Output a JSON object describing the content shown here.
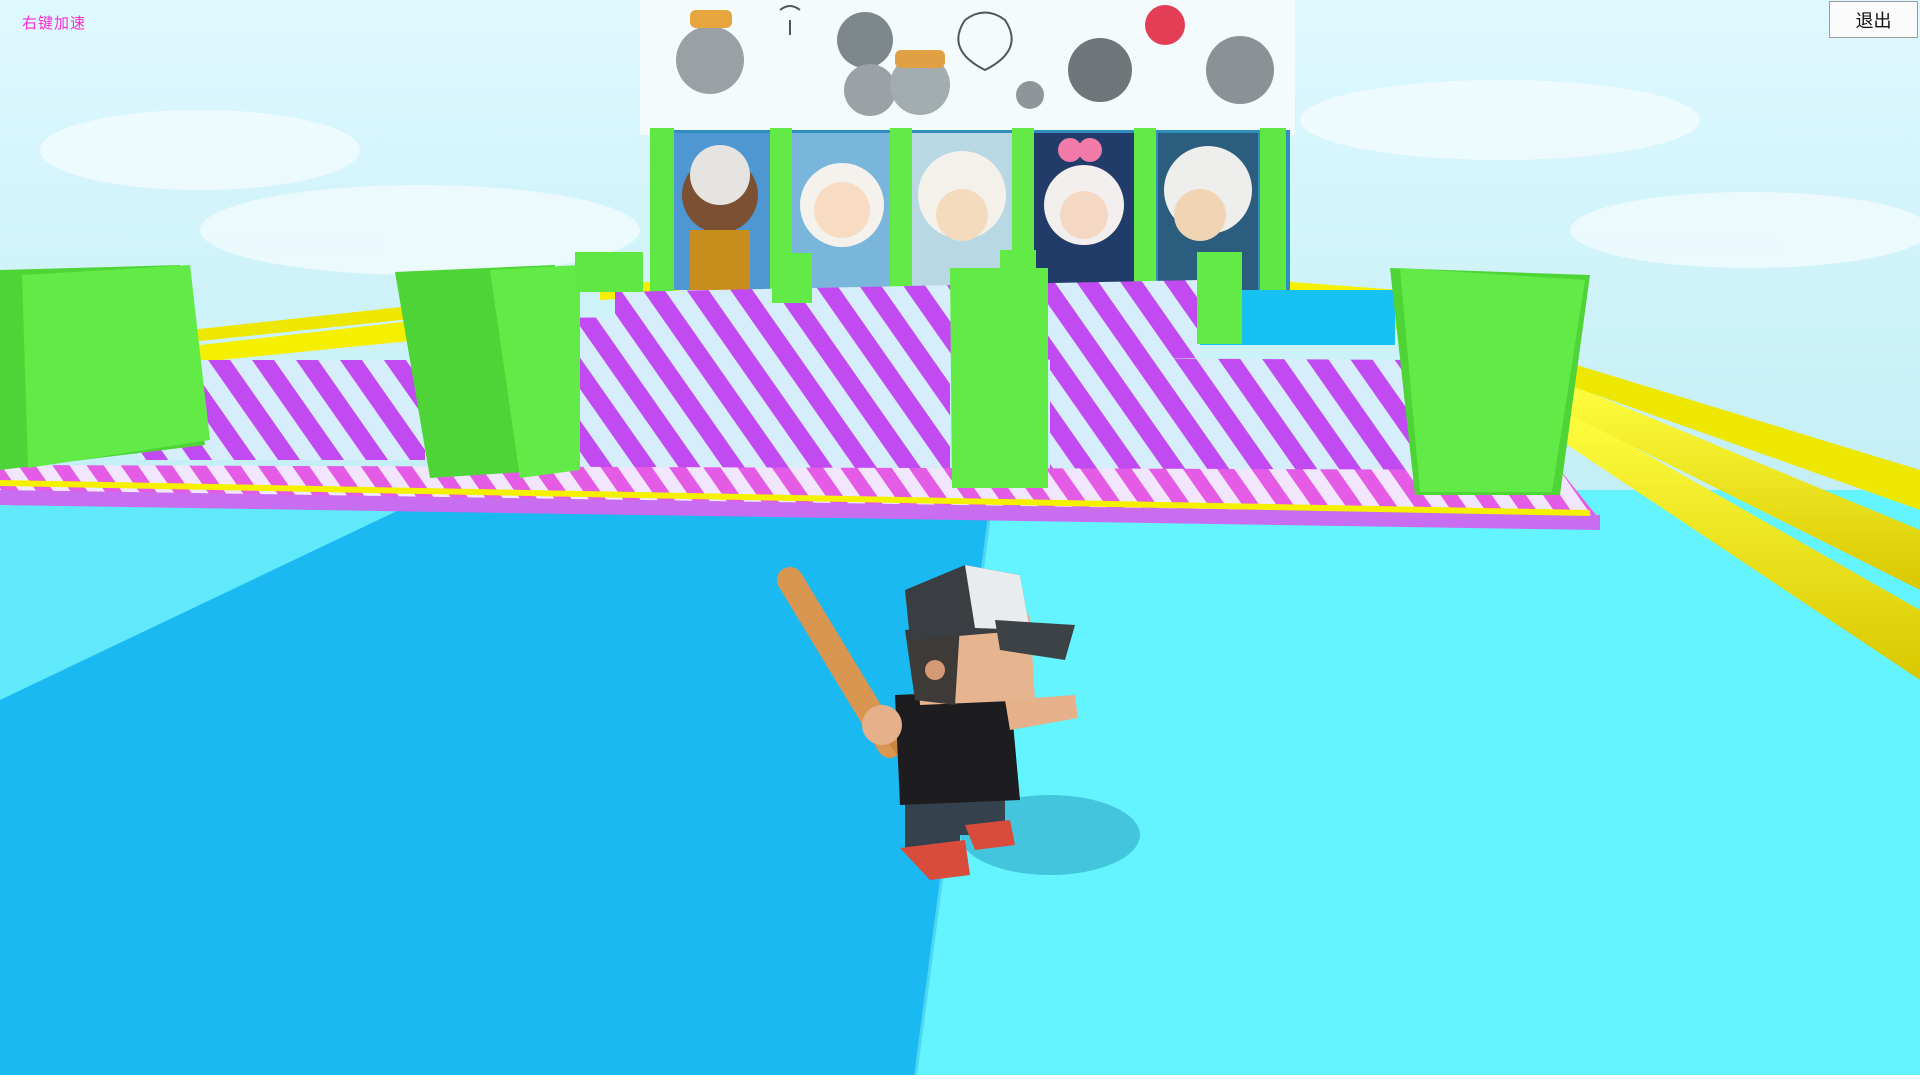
{
  "hud": {
    "hint_text": "右键加速",
    "exit_label": "退出"
  },
  "scene": {
    "billboard_posters": [
      "bearded-goat-poster",
      "white-goat-poster",
      "lazy-goat-poster",
      "pink-bow-goat-poster",
      "old-goat-poster"
    ],
    "billboard_top_image": "wolves-and-goats-doodle",
    "player_character": "baseball-kid-with-bat",
    "colors": {
      "sky_top": "#dff8ff",
      "sky_bottom": "#bdeef5",
      "floor_light": "#63f4ff",
      "floor_dark": "#1bb9f1",
      "barrier_green": "#66e84b",
      "rail_yellow": "#f4f000",
      "stripe_purple": "#c14bf0",
      "stripe_light": "#d6eefc",
      "hint_text": "#ff2bd6"
    }
  }
}
